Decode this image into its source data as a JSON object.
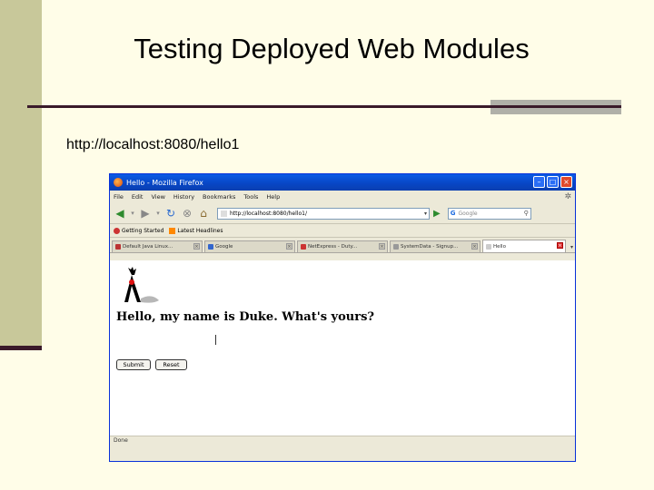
{
  "slide": {
    "title": "Testing Deployed Web Modules",
    "url_text": "http://localhost:8080/hello1"
  },
  "browser": {
    "window_title": "Hello - Mozilla Firefox",
    "menu": [
      "File",
      "Edit",
      "View",
      "History",
      "Bookmarks",
      "Tools",
      "Help"
    ],
    "address": "http://localhost:8080/hello1/",
    "search_placeholder": "Google",
    "bookmarks": [
      "Getting Started",
      "Latest Headlines"
    ],
    "tabs": [
      {
        "label": "Default Java Linux..."
      },
      {
        "label": "Google"
      },
      {
        "label": "NetExpress - Duty..."
      },
      {
        "label": "SystemData - Signup..."
      },
      {
        "label": "Hello"
      }
    ],
    "page": {
      "greeting": "Hello, my name is Duke. What's yours?",
      "submit_label": "Submit",
      "reset_label": "Reset"
    },
    "status": "Done"
  },
  "colors": {
    "background": "#fffde8",
    "sidebar": "#c8c89a",
    "rule": "#3a1a2a",
    "titlebar": "#0a5be4"
  }
}
